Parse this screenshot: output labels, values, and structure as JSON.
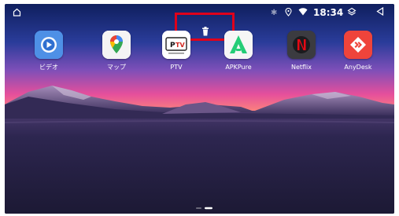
{
  "status_bar": {
    "time": "18:34",
    "icons": [
      "home-icon",
      "bluetooth-icon",
      "location-icon",
      "wifi-icon",
      "layers-icon",
      "back-icon"
    ]
  },
  "overlay": {
    "icon": "trash-icon",
    "highlight_color": "#e0001b"
  },
  "apps": [
    {
      "label": "ビデオ",
      "icon": "video-icon"
    },
    {
      "label": "マップ",
      "icon": "maps-icon"
    },
    {
      "label": "PTV",
      "icon": "ptv-icon"
    },
    {
      "label": "APKPure",
      "icon": "apkpure-icon"
    },
    {
      "label": "Netflix",
      "icon": "netflix-icon"
    },
    {
      "label": "AnyDesk",
      "icon": "anydesk-icon"
    }
  ],
  "colors": {
    "sky_top": "#1a2a6e",
    "horizon": "#f0509a",
    "ground": "#231f3d"
  },
  "pager": {
    "pages": 2,
    "current": 2
  }
}
